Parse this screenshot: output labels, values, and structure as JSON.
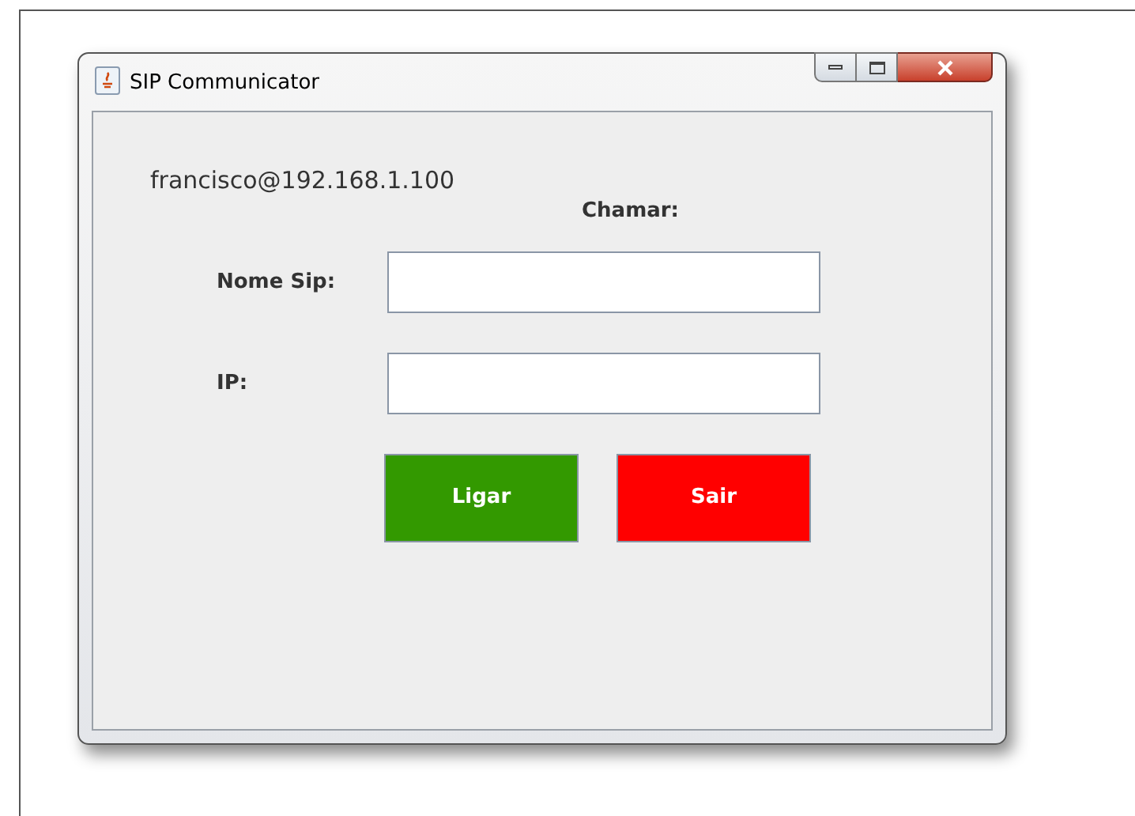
{
  "window": {
    "title": "SIP Communicator"
  },
  "user": "francisco@192.168.1.100",
  "call_heading": "Chamar:",
  "fields": [
    {
      "label": "Nome Sip:"
    },
    {
      "label": "IP:"
    }
  ],
  "buttons": [
    {
      "label": "Ligar",
      "color": "#339900"
    },
    {
      "label": "Sair",
      "color": "#ff0000"
    }
  ]
}
